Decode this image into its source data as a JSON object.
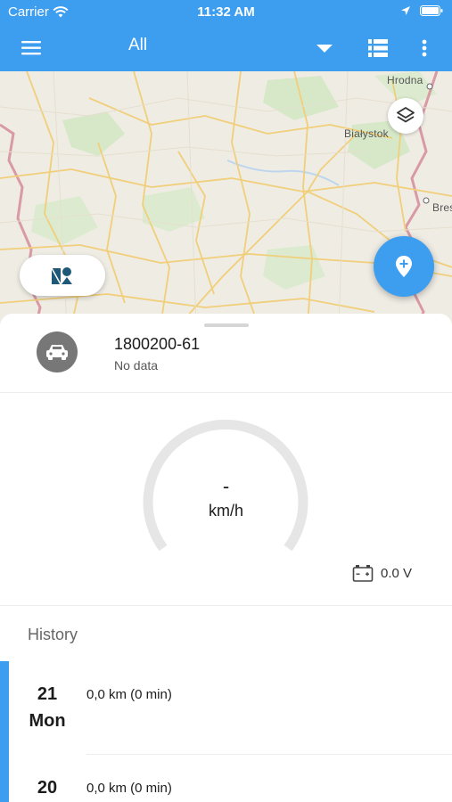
{
  "status_bar": {
    "carrier": "Carrier",
    "time": "11:32 AM"
  },
  "app_bar": {
    "filter_label": "All"
  },
  "map": {
    "cities": [
      "Hrodna",
      "Białystok",
      "Bres"
    ]
  },
  "vehicle": {
    "name": "1800200-61",
    "status": "No data"
  },
  "speed": {
    "value": "-",
    "unit": "km/h"
  },
  "battery": {
    "value": "0.0 V"
  },
  "history": {
    "title": "History",
    "days": [
      {
        "day": "21",
        "weekday": "Mon",
        "summary": "0,0 km (0 min)"
      },
      {
        "day": "20",
        "weekday": "",
        "summary": "0,0 km (0 min)"
      }
    ]
  },
  "colors": {
    "accent": "#3d9ef0",
    "gauge_track": "#e6e6e6",
    "avatar_bg": "#777777"
  }
}
